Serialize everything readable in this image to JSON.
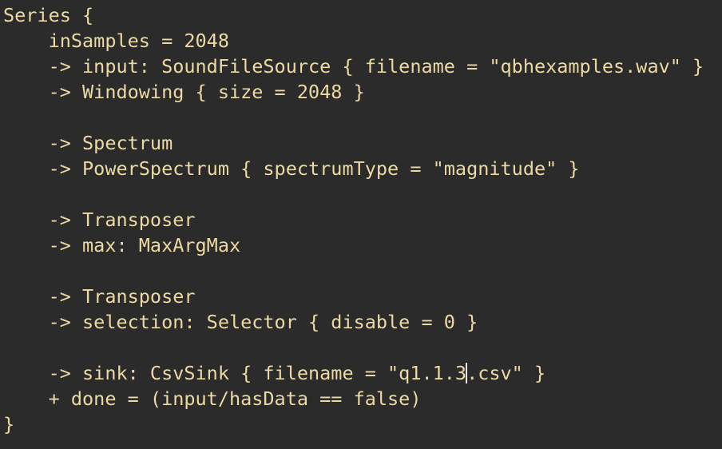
{
  "editor": {
    "lines": [
      "Series {",
      "    inSamples = 2048",
      "    -> input: SoundFileSource { filename = \"qbhexamples.wav\" }",
      "    -> Windowing { size = 2048 }",
      "",
      "    -> Spectrum",
      "    -> PowerSpectrum { spectrumType = \"magnitude\" }",
      "",
      "    -> Transposer",
      "    -> max: MaxArgMax",
      "",
      "    -> Transposer",
      "    -> selection: Selector { disable = 0 }",
      "",
      "    -> sink: CsvSink { filename = \"q1.1.3",
      "    + done = (input/hasData == false)",
      "}"
    ],
    "cursor_line_after_cursor": ".csv\" }",
    "text_color": "#ecd9a3",
    "background_color": "#2b2b2b"
  }
}
